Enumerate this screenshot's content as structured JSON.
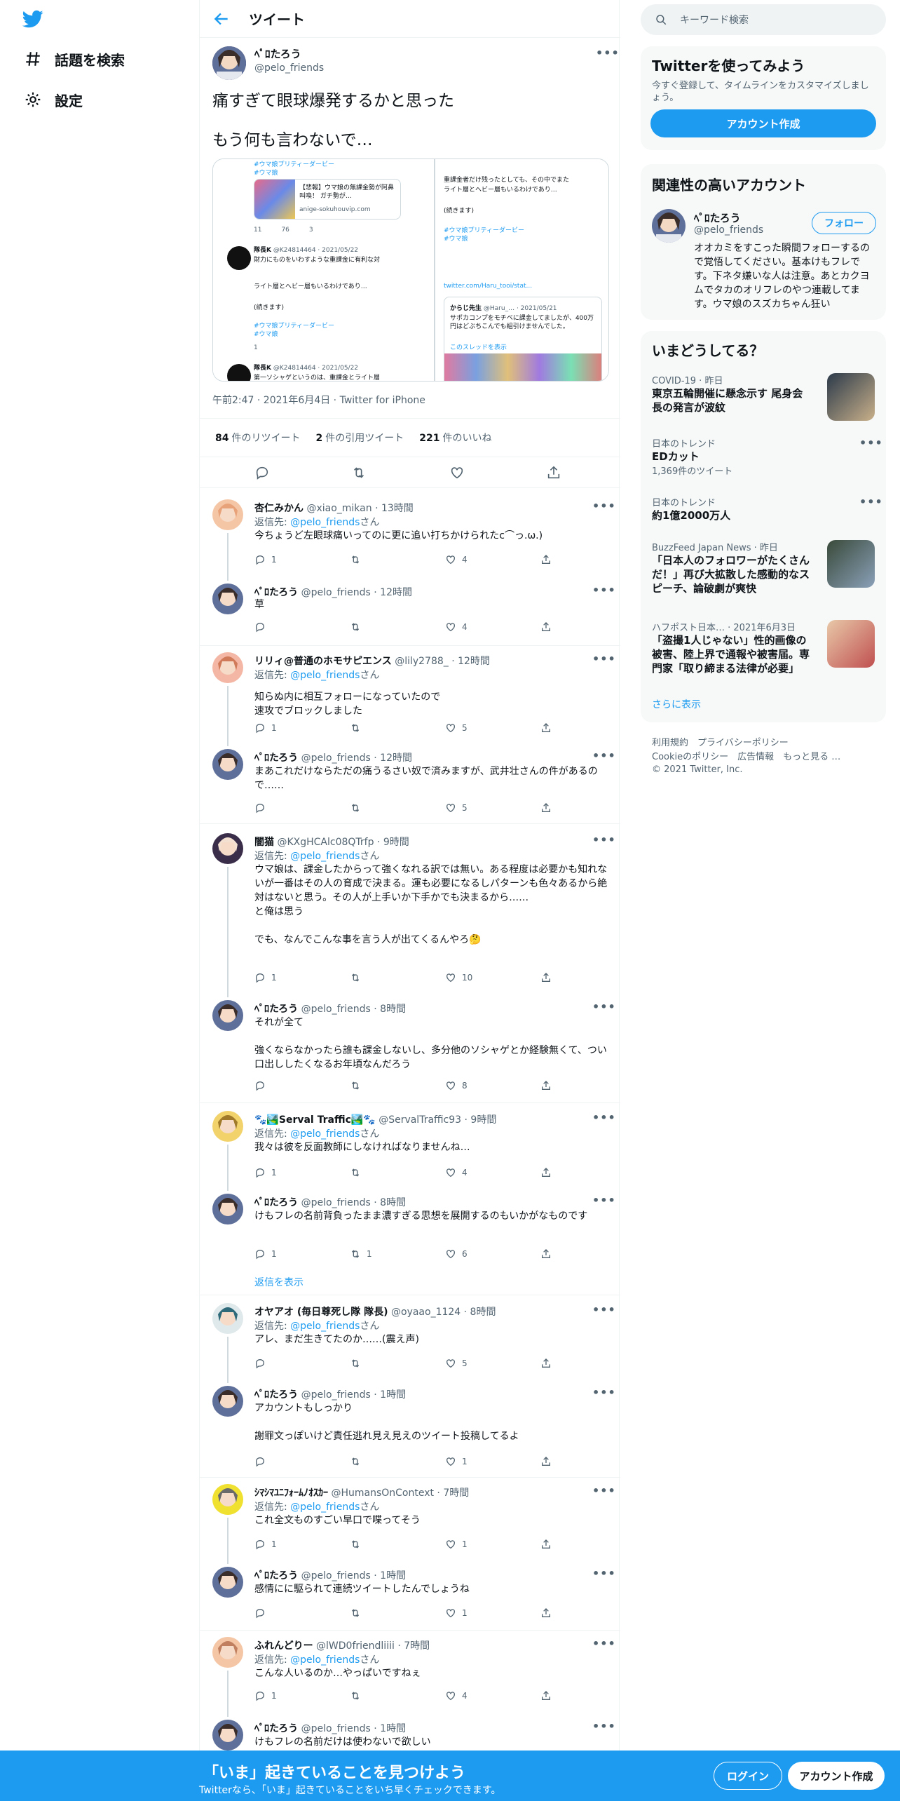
{
  "nav": {
    "explore": "話題を検索",
    "settings": "設定"
  },
  "header": {
    "title": "ツイート"
  },
  "tweet": {
    "name": "ﾍﾟﾛたろう",
    "handle": "@pelo_friends",
    "line1": "痛すぎて眼球爆発するかと思った",
    "line2": "もう何も言わないで…",
    "meta": "午前2:47 · 2021年6月4日 · Twitter for iPhone",
    "retweets_n": "84",
    "retweets_l": "件のリツイート",
    "quotes_n": "2",
    "quotes_l": "件の引用ツイート",
    "likes_n": "221",
    "likes_l": "件のいいね",
    "media": {
      "tag1": "#ウマ娘プリティーダービー",
      "tag2": "#ウマ娘",
      "link_title": "【悲報】ウマ娘の無課金勢が阿鼻叫喚！ ガチ勢が…",
      "link_domain": "anige-sokuhouvip.com",
      "c1": "11",
      "c2": "76",
      "c3": "3",
      "user1": "隊長K",
      "user1_meta": "@K24814464 · 2021/05/22",
      "t1": "財力にものをいわすような重課金に有利な対",
      "t2": "ライト層とヘビー層もいるわけであり…",
      "cont": "(続きます)",
      "cnt1": "1",
      "t3": "第一ソシャゲというのは、重課金とライト層",
      "r_top": "重課金者だけ残ったとしても、その中でまた",
      "r_top2": "ライト層とヘビー層もいるわけであり…",
      "r_cont": "(続きます)",
      "r_link": "twitter.com/Haru_tooi/stat...",
      "q_user": "からじ先生",
      "q_meta": "@Haru_… · 2021/05/21",
      "q_t1": "サポカコンプをモチベに課金してましたが、400万円はどぶちこんでも組引けませんでした。",
      "q_link": "このスレッドを表示"
    }
  },
  "replies": [
    {
      "name": "杏仁みかん",
      "handle": "@xiao_mikan · 13時間",
      "rto_pre": "返信先: ",
      "rto": "@pelo_friends",
      "rto_post": "さん",
      "body": "今ちょうど左眼球痛いってのに更に追い打ちかけられたc⌒っ.ω.)",
      "reply": "1",
      "rt": "",
      "like": "4"
    },
    {
      "name": "ﾍﾟﾛたろう",
      "handle": "@pelo_friends · 12時間",
      "body": "草",
      "reply": "",
      "rt": "",
      "like": "4"
    },
    {
      "name": "リリィ@普通のホモサピエンス",
      "handle": "@lily2788_ · 12時間",
      "rto_pre": "返信先: ",
      "rto": "@pelo_friends",
      "rto_post": "さん",
      "body": "知らぬ内に相互フォローになっていたので\n速攻でブロックしました",
      "reply": "1",
      "rt": "",
      "like": "5"
    },
    {
      "name": "ﾍﾟﾛたろう",
      "handle": "@pelo_friends · 12時間",
      "body": "まあこれだけならただの痛うるさい奴で済みますが、武井壮さんの件があるので……",
      "reply": "",
      "rt": "",
      "like": "5"
    },
    {
      "name": "闇猫",
      "handle": "@KXgHCAlc08QTrfp · 9時間",
      "rto_pre": "返信先: ",
      "rto": "@pelo_friends",
      "rto_post": "さん",
      "body": "ウマ娘は、課金したからって強くなれる訳では無い。ある程度は必要かも知れないが一番はその人の育成で決まる。運も必要になるしパターンも色々あるから絶対はないと思う。その人が上手いか下手かでも決まるから……\nと俺は思う\n\nでも、なんでこんな事を言う人が出てくるんやろ🤔",
      "reply": "1",
      "rt": "",
      "like": "10"
    },
    {
      "name": "ﾍﾟﾛたろう",
      "handle": "@pelo_friends · 8時間",
      "body": "それが全て\n\n強くならなかったら誰も課金しないし、多分他のソシャゲとか経験無くて、つい口出ししたくなるお年頃なんだろう",
      "reply": "",
      "rt": "",
      "like": "8"
    },
    {
      "name": "🐾🏞️Serval Traffic🏞️🐾",
      "handle": "@ServalTraffic93 · 9時間",
      "rto_pre": "返信先: ",
      "rto": "@pelo_friends",
      "rto_post": "さん",
      "body": "我々は彼を反面教師にしなければなりませんね…",
      "reply": "1",
      "rt": "",
      "like": "4"
    },
    {
      "name": "ﾍﾟﾛたろう",
      "handle": "@pelo_friends · 8時間",
      "body": "けもフレの名前背負ったまま濃すぎる思想を展開するのもいかがなものです",
      "reply": "1",
      "rt": "1",
      "like": "6"
    },
    {
      "name": "オヤアオ (毎日尊死し隊 隊長)",
      "handle": "@oyaao_1124 · 8時間",
      "rto_pre": "返信先: ",
      "rto": "@pelo_friends",
      "rto_post": "さん",
      "body": "アレ、まだ生きてたのか……(震え声)",
      "reply": "",
      "rt": "",
      "like": "5"
    },
    {
      "name": "ﾍﾟﾛたろう",
      "handle": "@pelo_friends · 1時間",
      "body": "アカウントもしっかり\n\n謝罪文っぽいけど責任逃れ見え見えのツイート投稿してるよ",
      "reply": "",
      "rt": "",
      "like": "1"
    },
    {
      "name": "ｼﾏｼﾏﾕﾆﾌｫｰﾑﾉｵｽｶｰ",
      "handle": "@HumansOnContext · 7時間",
      "rto_pre": "返信先: ",
      "rto": "@pelo_friends",
      "rto_post": "さん",
      "body": "これ全文ものすごい早口で喋ってそう",
      "reply": "1",
      "rt": "",
      "like": "1"
    },
    {
      "name": "ﾍﾟﾛたろう",
      "handle": "@pelo_friends · 1時間",
      "body": "感情にに駆られて連続ツイートしたんでしょうね",
      "reply": "",
      "rt": "",
      "like": "1"
    },
    {
      "name": "ふれんどりー",
      "handle": "@lWD0friendliiii · 7時間",
      "rto_pre": "返信先: ",
      "rto": "@pelo_friends",
      "rto_post": "さん",
      "body": "こんな人いるのか…やっぱいですねぇ",
      "reply": "1",
      "rt": "",
      "like": "4"
    },
    {
      "name": "ﾍﾟﾛたろう",
      "handle": "@pelo_friends · 1時間",
      "body": "けもフレの名前だけは使わないで欲しい",
      "reply": "",
      "rt": "",
      "like": ""
    }
  ],
  "show_replies": "返信を表示",
  "right": {
    "search_placeholder": "キーワード検索",
    "signup_title": "Twitterを使ってみよう",
    "signup_desc": "今すぐ登録して、タイムラインをカスタマイズしましょう。",
    "signup_button": "アカウント作成",
    "related_title": "関連性の高いアカウント",
    "related_name": "ﾍﾟﾛたろう",
    "related_handle": "@pelo_friends",
    "follow": "フォロー",
    "related_bio": "オオカミをすこった瞬間フォローするので覚悟してください。基本けもフレです。下ネタ嫌いな人は注意。あとカクヨムでタカのオリフレのやつ連載してます。ウマ娘のスズカちゃん狂い",
    "trends_title": "いまどうしてる？",
    "trends": [
      {
        "cat": "COVID-19 · 昨日",
        "title": "東京五輪開催に懸念示す 尾身会長の発言が波紋",
        "sub": ""
      },
      {
        "cat": "日本のトレンド",
        "title": "EDカット",
        "sub": "1,369件のツイート"
      },
      {
        "cat": "日本のトレンド",
        "title": "約1億2000万人",
        "sub": ""
      },
      {
        "cat": "BuzzFeed Japan News · 昨日",
        "title": "「日本人のフォロワーがたくさんだ！」再び大拡散した感動的なスピーチ、論破劇が爽快",
        "sub": ""
      },
      {
        "cat": "ハフポスト日本… · 2021年6月3日",
        "title": "「盗撮1人じゃない」性的画像の被害、陸上界で通報や被害届。専門家「取り締まる法律が必要」",
        "sub": ""
      }
    ],
    "show_more": "さらに表示",
    "footer1": "利用規約　プライバシーポリシー",
    "footer2": "Cookieのポリシー　広告情報　もっと見る …",
    "footer3": "© 2021 Twitter, Inc."
  },
  "bottom": {
    "title": "「いま」起きていることを見つけよう",
    "sub": "Twitterなら、「いま」起きていることをいち早くチェックできます。",
    "login": "ログイン",
    "signup": "アカウント作成"
  },
  "colors": {
    "accent": "#1d9bf0",
    "text": "#0f1419",
    "muted": "#536471"
  }
}
